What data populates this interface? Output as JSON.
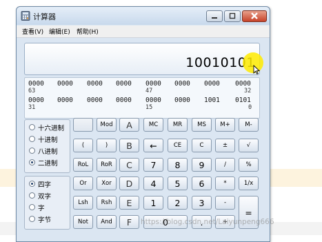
{
  "window": {
    "title": "计算器"
  },
  "menu": [
    "查看(V)",
    "编辑(E)",
    "帮助(H)"
  ],
  "display": {
    "value": "10010101"
  },
  "bits": {
    "row1_groups": [
      "0000",
      "0000",
      "0000",
      "0000",
      "0000",
      "0000",
      "0000",
      "0000"
    ],
    "row1_positions": [
      "63",
      "47",
      "32"
    ],
    "row2_groups": [
      "0000",
      "0000",
      "0000",
      "0000",
      "0000",
      "0000",
      "1001",
      "0101"
    ],
    "row2_positions": [
      "31",
      "15",
      "0"
    ]
  },
  "base_options": [
    {
      "label": "十六进制",
      "selected": false
    },
    {
      "label": "十进制",
      "selected": false
    },
    {
      "label": "八进制",
      "selected": false
    },
    {
      "label": "二进制",
      "selected": true
    }
  ],
  "word_options": [
    {
      "label": "四字",
      "selected": true
    },
    {
      "label": "双字",
      "selected": false
    },
    {
      "label": "字",
      "selected": false
    },
    {
      "label": "字节",
      "selected": false
    }
  ],
  "keys": {
    "r1": [
      "",
      "Mod",
      "A",
      "MC",
      "MR",
      "MS",
      "M+",
      "M-"
    ],
    "r2": [
      "(",
      ")",
      "B",
      "←",
      "CE",
      "C",
      "±",
      "√"
    ],
    "r3": [
      "RoL",
      "RoR",
      "C",
      "7",
      "8",
      "9",
      "/",
      "%"
    ],
    "r4": [
      "Or",
      "Xor",
      "D",
      "4",
      "5",
      "6",
      "*",
      "1/x"
    ],
    "r5": [
      "Lsh",
      "Rsh",
      "E",
      "1",
      "2",
      "3",
      "-",
      "="
    ],
    "r6": [
      "Not",
      "And",
      "F",
      "0",
      ".",
      "+"
    ]
  },
  "watermark": "https://blog.csdn.net/Laiyunpeng666"
}
